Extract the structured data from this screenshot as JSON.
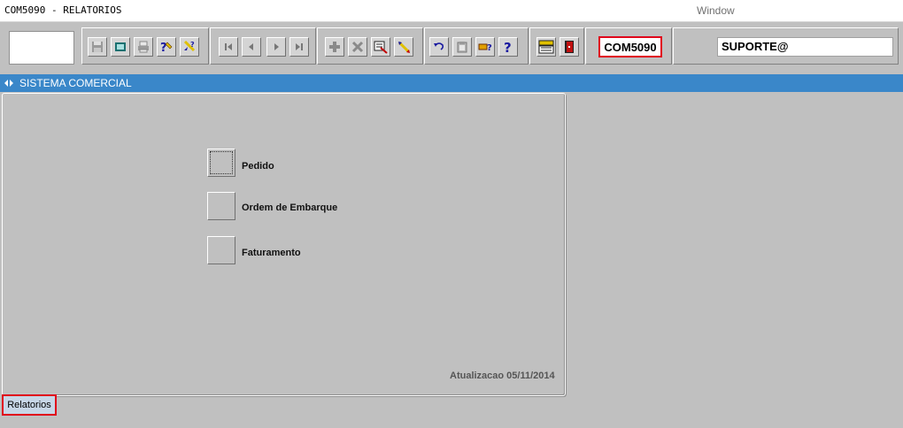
{
  "window": {
    "title": "COM5090 - RELATORIOS",
    "menu": "Window"
  },
  "toolbar": {
    "form_code": "COM5090",
    "user": "SUPORTE@",
    "buttons": [
      {
        "name": "save-icon"
      },
      {
        "name": "window-icon"
      },
      {
        "name": "print-icon"
      },
      {
        "name": "query-help-icon"
      },
      {
        "name": "execute-query-icon"
      },
      {
        "name": "first-record-icon"
      },
      {
        "name": "previous-record-icon"
      },
      {
        "name": "next-record-icon"
      },
      {
        "name": "last-record-icon"
      },
      {
        "name": "insert-record-icon"
      },
      {
        "name": "delete-record-icon"
      },
      {
        "name": "clear-form-icon"
      },
      {
        "name": "edit-icon"
      },
      {
        "name": "undo-icon"
      },
      {
        "name": "paste-icon"
      },
      {
        "name": "key-help-icon"
      },
      {
        "name": "help-icon"
      },
      {
        "name": "menu-icon"
      },
      {
        "name": "exit-icon"
      }
    ]
  },
  "system": {
    "title": "SISTEMA COMERCIAL"
  },
  "options": [
    {
      "label": "Pedido"
    },
    {
      "label": "Ordem de Embarque"
    },
    {
      "label": "Faturamento"
    }
  ],
  "footer": {
    "updated": "Atualizacao 05/11/2014",
    "tab": "Relatorios"
  }
}
